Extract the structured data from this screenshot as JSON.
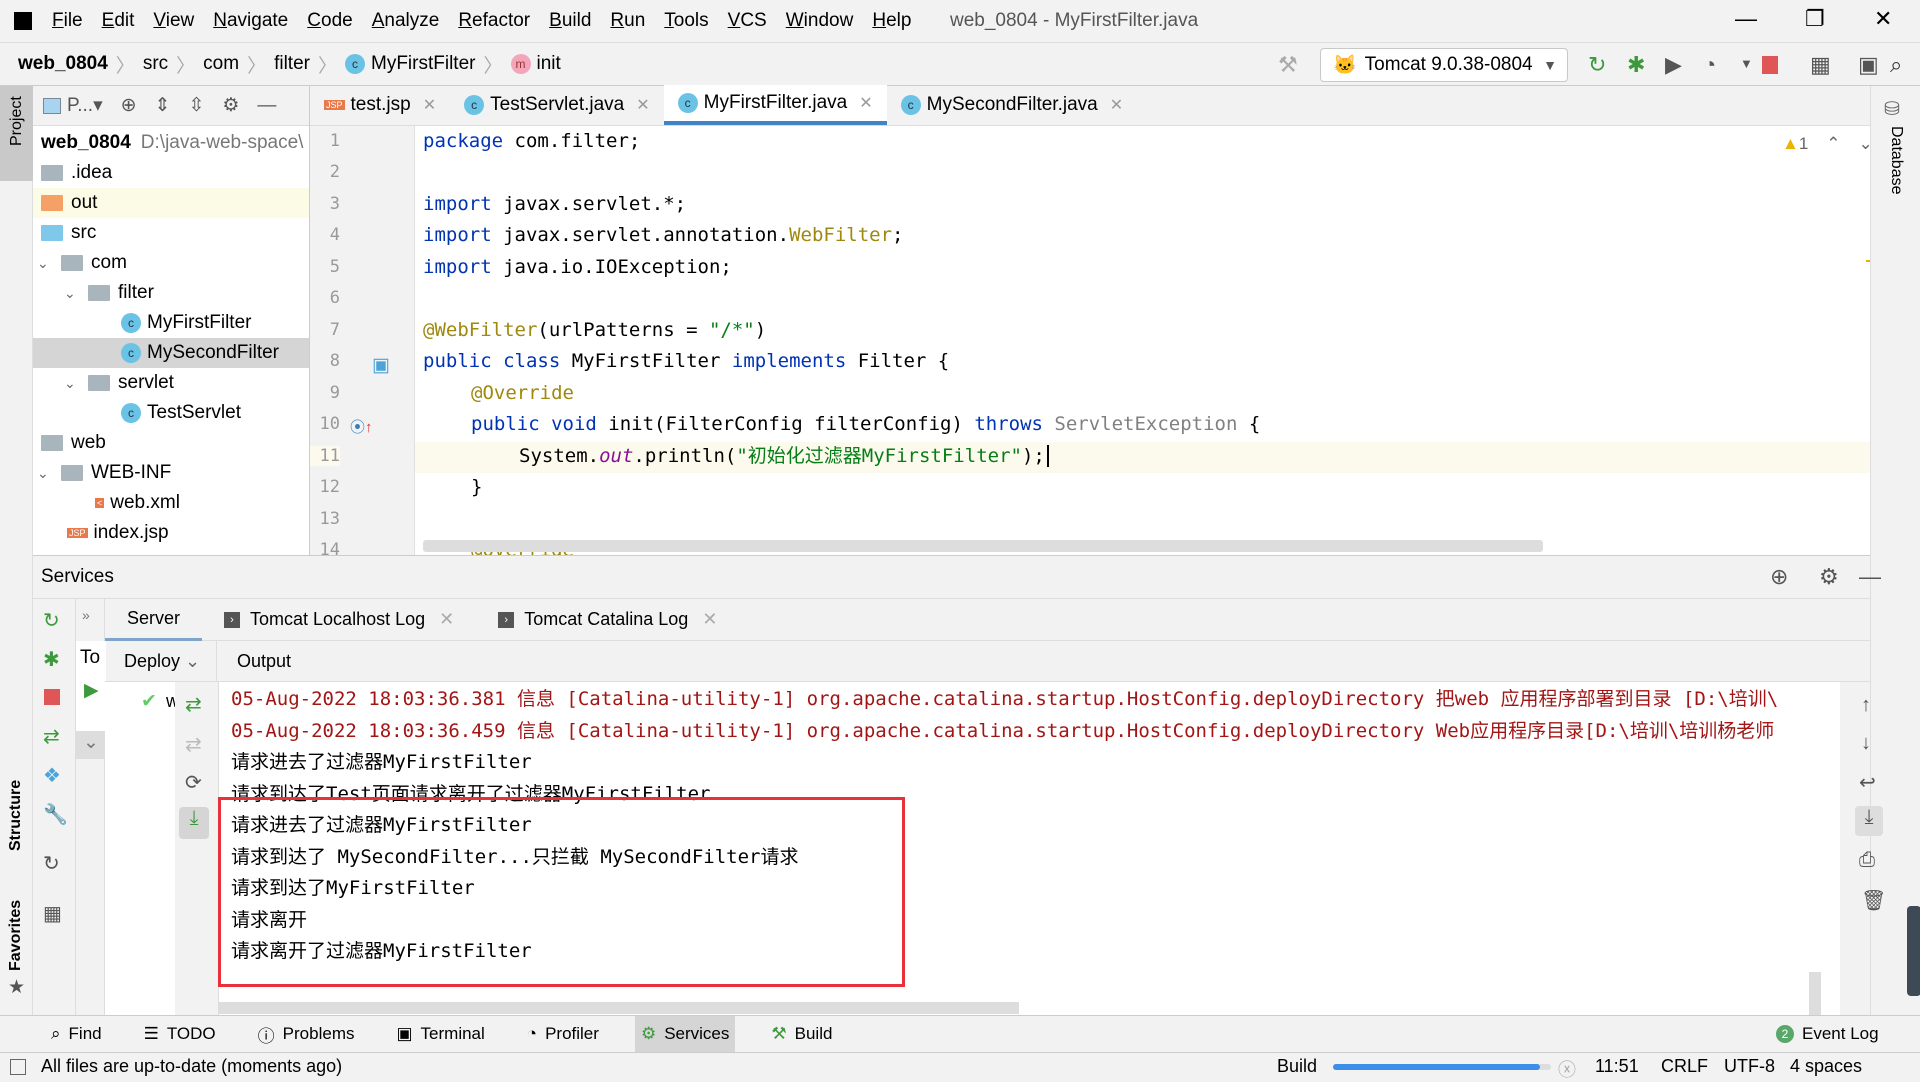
{
  "window": {
    "title": "web_0804 - MyFirstFilter.java",
    "minimize": "—",
    "restore": "❐",
    "close": "✕"
  },
  "menu": [
    "File",
    "Edit",
    "View",
    "Navigate",
    "Code",
    "Analyze",
    "Refactor",
    "Build",
    "Run",
    "Tools",
    "VCS",
    "Window",
    "Help"
  ],
  "breadcrumb": [
    "web_0804",
    "src",
    "com",
    "filter",
    "MyFirstFilter",
    "init"
  ],
  "run_config": "Tomcat 9.0.38-0804",
  "left_strip": {
    "project": "Project",
    "structure": "Structure",
    "favorites": "Favorites"
  },
  "right_strip": {
    "database": "Database"
  },
  "project": {
    "toolbar_label": "P...",
    "root": "web_0804",
    "root_path": "D:\\java-web-space\\",
    "items": [
      ".idea",
      "out",
      "src",
      "com",
      "filter",
      "MyFirstFilter",
      "MySecondFilter",
      "servlet",
      "TestServlet",
      "web",
      "WEB-INF",
      "web.xml",
      "index.jsp"
    ]
  },
  "editor": {
    "tabs": [
      "test.jsp",
      "TestServlet.java",
      "MyFirstFilter.java",
      "MySecondFilter.java"
    ],
    "active_tab": 2,
    "warnings": "1",
    "line_numbers": [
      "1",
      "2",
      "3",
      "4",
      "5",
      "6",
      "7",
      "8",
      "9",
      "10",
      "11",
      "12",
      "13",
      "14"
    ]
  },
  "code": {
    "l1a": "package ",
    "l1b": "com.filter;",
    "l3a": "import ",
    "l3b": "javax.servlet.*;",
    "l4a": "import ",
    "l4b": "javax.servlet.annotation.",
    "l4c": "WebFilter",
    "l4d": ";",
    "l5a": "import ",
    "l5b": "java.io.IOException;",
    "l7a": "@WebFilter",
    "l7b": "(urlPatterns = ",
    "l7c": "\"/*\"",
    "l7d": ")",
    "l8a": "public class ",
    "l8b": "MyFirstFilter ",
    "l8c": "implements ",
    "l8d": "Filter {",
    "l9": "@Override",
    "l10a": "public void ",
    "l10b": "init(FilterConfig filterConfig) ",
    "l10c": "throws ",
    "l10d": "ServletException ",
    "l10e": "{",
    "l11a": "System.",
    "l11b": "out",
    "l11c": ".println(",
    "l11d": "\"初始化过滤器MyFirstFilter\"",
    "l11e": ");",
    "l12": "}",
    "l14": "@Override"
  },
  "services": {
    "title": "Services",
    "tabs": [
      "Server",
      "Tomcat Localhost Log",
      "Tomcat Catalina Log"
    ],
    "tree_item": "To",
    "deploy": "Deploy",
    "deploy_item": "web",
    "output": "Output",
    "log": [
      "05-Aug-2022 18:03:36.381 信息 [Catalina-utility-1] org.apache.catalina.startup.HostConfig.deployDirectory 把web 应用程序部署到目录 [D:\\培训\\",
      "05-Aug-2022 18:03:36.459 信息 [Catalina-utility-1] org.apache.catalina.startup.HostConfig.deployDirectory Web应用程序目录[D:\\培训\\培训杨老师",
      "请求进去了过滤器MyFirstFilter",
      "请求到达了Test页面请求离开了过滤器MyFirstFilter",
      "请求进去了过滤器MyFirstFilter",
      "请求到达了 MySecondFilter...只拦截 MySecondFilter请求",
      "请求到达了MyFirstFilter",
      "请求离开",
      "请求离开了过滤器MyFirstFilter"
    ]
  },
  "bottom_tabs": [
    "Find",
    "TODO",
    "Problems",
    "Terminal",
    "Profiler",
    "Services",
    "Build"
  ],
  "event_log": {
    "count": "2",
    "label": "Event Log"
  },
  "status": {
    "message": "All files are up-to-date (moments ago)",
    "build": "Build",
    "build_progress": 0.95,
    "position": "11:51",
    "line_sep": "CRLF",
    "encoding": "UTF-8",
    "indent": "4 spaces"
  },
  "colors": {
    "accent": "#4083c9",
    "highlight_box": "#e8313a",
    "log_red": "#a31515"
  }
}
